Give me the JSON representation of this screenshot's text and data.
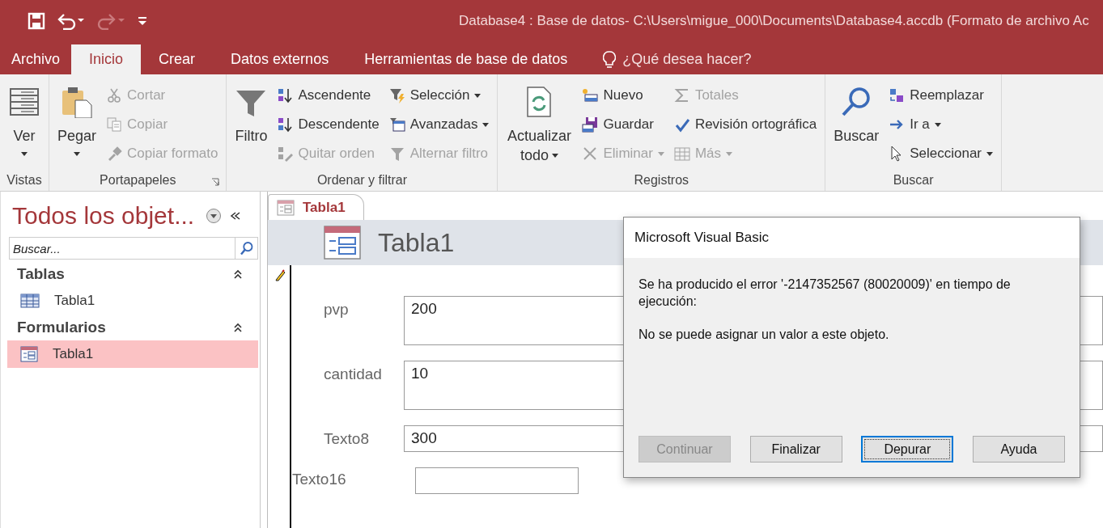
{
  "window": {
    "title": "Database4 : Base de datos- C:\\Users\\migue_000\\Documents\\Database4.accdb (Formato de archivo Ac"
  },
  "ribbon_tabs": [
    {
      "label": "Archivo",
      "selected": false
    },
    {
      "label": "Inicio",
      "selected": true
    },
    {
      "label": "Crear",
      "selected": false
    },
    {
      "label": "Datos externos",
      "selected": false
    },
    {
      "label": "Herramientas de base de datos",
      "selected": false
    }
  ],
  "tell_me": "¿Qué desea hacer?",
  "ribbon_groups": [
    {
      "label": "Vistas",
      "launcher": false,
      "large": [
        {
          "label": "Ver",
          "dropdown": true,
          "disabled": false
        }
      ]
    },
    {
      "label": "Portapapeles",
      "launcher": true,
      "large": [
        {
          "label": "Pegar",
          "dropdown": true,
          "disabled": false
        }
      ],
      "columns": [
        [
          {
            "label": "Cortar",
            "dropdown": false,
            "disabled": true
          },
          {
            "label": "Copiar",
            "dropdown": false,
            "disabled": true
          },
          {
            "label": "Copiar formato",
            "dropdown": false,
            "disabled": true
          }
        ]
      ]
    },
    {
      "label": "Ordenar y filtrar",
      "launcher": false,
      "large": [
        {
          "label": "Filtro",
          "dropdown": false,
          "disabled": false
        }
      ],
      "columns": [
        [
          {
            "label": "Ascendente",
            "dropdown": false,
            "disabled": false
          },
          {
            "label": "Descendente",
            "dropdown": false,
            "disabled": false
          },
          {
            "label": "Quitar orden",
            "dropdown": false,
            "disabled": true
          }
        ],
        [
          {
            "label": "Selección",
            "dropdown": true,
            "disabled": false
          },
          {
            "label": "Avanzadas",
            "dropdown": true,
            "disabled": false
          },
          {
            "label": "Alternar filtro",
            "dropdown": false,
            "disabled": true
          }
        ]
      ]
    },
    {
      "label": "Registros",
      "launcher": false,
      "large": [
        {
          "label": "Actualizar todo",
          "dropdown": true,
          "disabled": false
        }
      ],
      "columns": [
        [
          {
            "label": "Nuevo",
            "dropdown": false,
            "disabled": false
          },
          {
            "label": "Guardar",
            "dropdown": false,
            "disabled": false
          },
          {
            "label": "Eliminar",
            "dropdown": true,
            "disabled": true
          }
        ],
        [
          {
            "label": "Totales",
            "dropdown": false,
            "disabled": true
          },
          {
            "label": "Revisión ortográfica",
            "dropdown": false,
            "disabled": false
          },
          {
            "label": "Más",
            "dropdown": true,
            "disabled": true
          }
        ]
      ]
    },
    {
      "label": "Buscar",
      "launcher": false,
      "large": [
        {
          "label": "Buscar",
          "dropdown": false,
          "disabled": false
        }
      ],
      "columns": [
        [
          {
            "label": "Reemplazar",
            "dropdown": false,
            "disabled": false
          },
          {
            "label": "Ir a",
            "dropdown": true,
            "disabled": false
          },
          {
            "label": "Seleccionar",
            "dropdown": true,
            "disabled": false
          }
        ]
      ]
    }
  ],
  "nav_pane": {
    "title": "Todos los objet...",
    "search": {
      "placeholder": "Buscar..."
    },
    "sections": [
      {
        "label": "Tablas",
        "expanded": true,
        "items": [
          {
            "label": "Tabla1",
            "kind": "table",
            "selected": false
          }
        ]
      },
      {
        "label": "Formularios",
        "expanded": true,
        "items": [
          {
            "label": "Tabla1",
            "kind": "form",
            "selected": true
          }
        ]
      }
    ]
  },
  "document_tabs": [
    {
      "label": "Tabla1",
      "selected": true
    }
  ],
  "form": {
    "title": "Tabla1",
    "record_editing": true,
    "fields": [
      {
        "label": "pvp",
        "value": "200",
        "kind": "tall"
      },
      {
        "label": "cantidad",
        "value": "10",
        "kind": "tall"
      },
      {
        "label": "Texto8",
        "value": "300",
        "kind": "short"
      },
      {
        "label": "Texto16",
        "kind": "unbound"
      }
    ]
  },
  "dialog": {
    "title": "Microsoft Visual Basic",
    "message": "Se ha producido el error '-2147352567 (80020009)' en tiempo de ejecución:",
    "detail": "No se puede asignar un valor a este objeto.",
    "buttons": [
      {
        "label": "Continuar",
        "disabled": true,
        "focused": false
      },
      {
        "label": "Finalizar",
        "disabled": false,
        "focused": false
      },
      {
        "label": "Depurar",
        "disabled": false,
        "focused": true
      },
      {
        "label": "Ayuda",
        "disabled": false,
        "focused": false
      }
    ]
  }
}
